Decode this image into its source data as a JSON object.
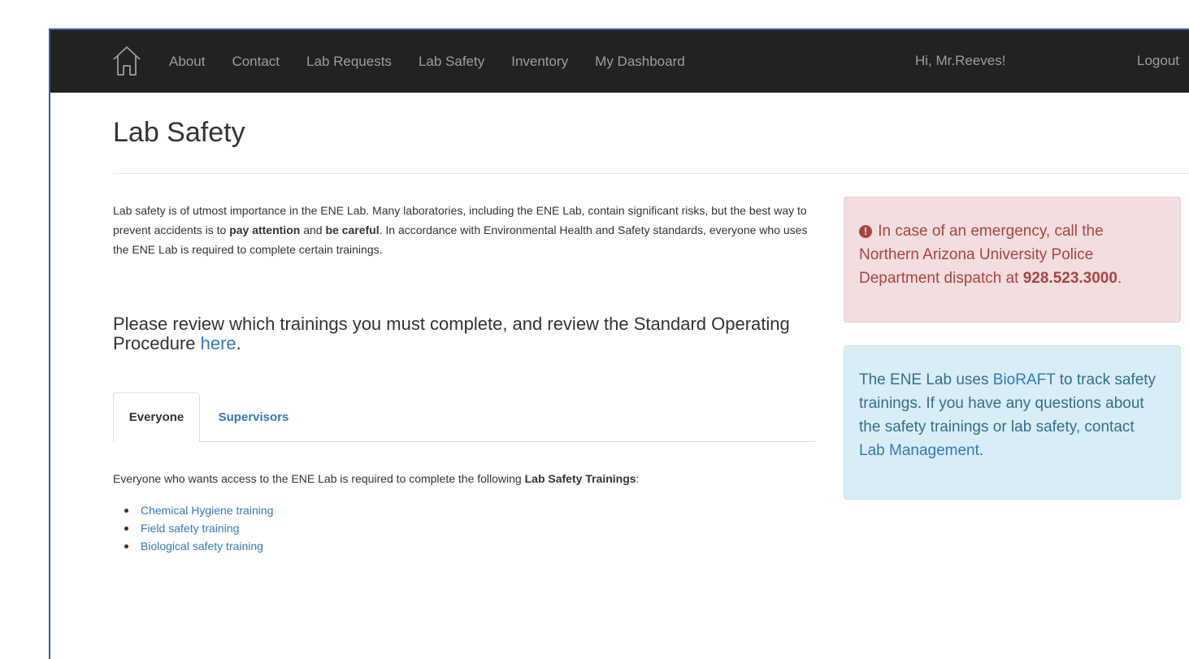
{
  "navbar": {
    "home_icon": "home-icon",
    "items": [
      "About",
      "Contact",
      "Lab Requests",
      "Lab Safety",
      "Inventory",
      "My Dashboard"
    ],
    "greeting": "Hi, Mr.Reeves!",
    "logout": "Logout"
  },
  "page": {
    "title": "Lab Safety",
    "intro": {
      "part1": "Lab safety is of utmost importance in the ENE Lab. Many laboratories, including the ENE Lab, contain significant risks, but the best way to prevent accidents is to ",
      "bold1": "pay attention",
      "part2": " and ",
      "bold2": "be careful",
      "part3": ". In accordance with Environmental Health and Safety standards, everyone who uses the ENE Lab is required to complete certain trainings."
    },
    "review": {
      "text": "Please review which trainings you must complete, and review the Standard Operating Procedure ",
      "link": "here",
      "end": "."
    },
    "tabs": [
      {
        "label": "Everyone",
        "active": true
      },
      {
        "label": "Supervisors",
        "active": false
      }
    ],
    "everyone": {
      "text": "Everyone who wants access to the ENE Lab is required to complete the following ",
      "bold": "Lab Safety Trainings",
      "end": ":",
      "trainings": [
        "Chemical Hygiene training",
        "Field safety training",
        "Biological safety training"
      ]
    }
  },
  "sidebar": {
    "emergency": {
      "icon": "exclamation-circle-icon",
      "text": "In case of an emergency, call the Northern Arizona University Police Department dispatch at ",
      "phone": "928.523.3000",
      "end": "."
    },
    "info": {
      "text1": "The ENE Lab uses ",
      "link1": "BioRAFT",
      "text2": " to track safety trainings. If you have any questions about the safety trainings or lab safety, contact ",
      "link2": "Lab Management",
      "end": "."
    }
  },
  "colors": {
    "navbar_bg": "#222222",
    "nav_text": "#9d9d9d",
    "link": "#337ab7",
    "danger_bg": "#f2dede",
    "danger_text": "#a94442",
    "info_bg": "#d9edf7",
    "info_text": "#31708f"
  }
}
